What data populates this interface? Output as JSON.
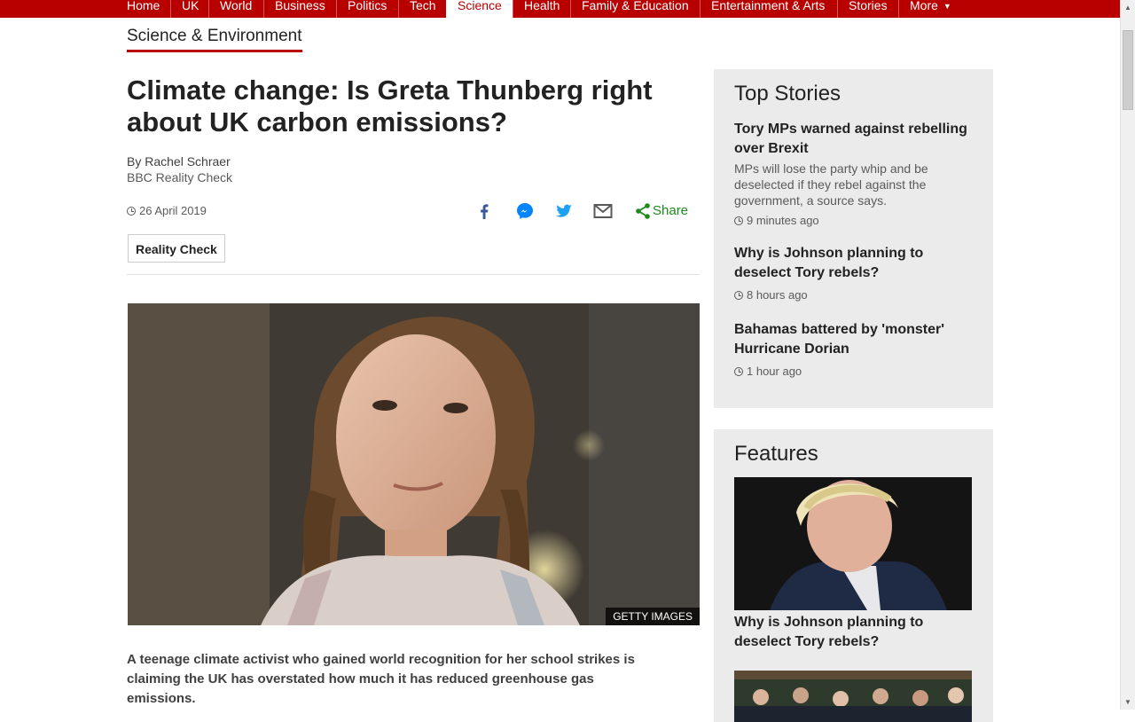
{
  "nav": {
    "items": [
      {
        "label": "Home"
      },
      {
        "label": "UK"
      },
      {
        "label": "World"
      },
      {
        "label": "Business"
      },
      {
        "label": "Politics"
      },
      {
        "label": "Tech"
      },
      {
        "label": "Science",
        "active": true
      },
      {
        "label": "Health"
      },
      {
        "label": "Family & Education"
      },
      {
        "label": "Entertainment & Arts"
      },
      {
        "label": "Stories"
      },
      {
        "label": "More"
      }
    ]
  },
  "section": {
    "title": "Science & Environment"
  },
  "article": {
    "headline": "Climate change: Is Greta Thunberg right about UK carbon emissions?",
    "author": "By Rachel Schraer",
    "author_role": "BBC Reality Check",
    "date": "26 April 2019",
    "share_label": "Share",
    "tag": "Reality Check",
    "image_credit": "GETTY IMAGES",
    "lead": "A teenage climate activist who gained world recognition for her school strikes is claiming the UK has overstated how much it has reduced greenhouse gas emissions."
  },
  "top_stories": {
    "title": "Top Stories",
    "items": [
      {
        "title": "Tory MPs warned against rebelling over Brexit",
        "summary": "MPs will lose the party whip and be deselected if they rebel against the government, a source says.",
        "time": "9 minutes ago"
      },
      {
        "title": "Why is Johnson planning to deselect Tory rebels?",
        "time": "8 hours ago"
      },
      {
        "title": "Bahamas battered by 'monster' Hurricane Dorian",
        "time": "1 hour ago"
      }
    ]
  },
  "features": {
    "title": "Features",
    "items": [
      {
        "caption": "Why is Johnson planning to deselect Tory rebels?"
      }
    ]
  },
  "colors": {
    "brand_red": "#b80000",
    "share_green": "#1b8a1b",
    "facebook_blue": "#3b5998",
    "messenger_blue": "#0084ff",
    "twitter_blue": "#1da1f2",
    "sidebar_bg": "#ebebeb"
  },
  "icons": [
    "clock-icon",
    "facebook-icon",
    "messenger-icon",
    "twitter-icon",
    "email-icon",
    "share-icon",
    "chevron-down-icon"
  ]
}
